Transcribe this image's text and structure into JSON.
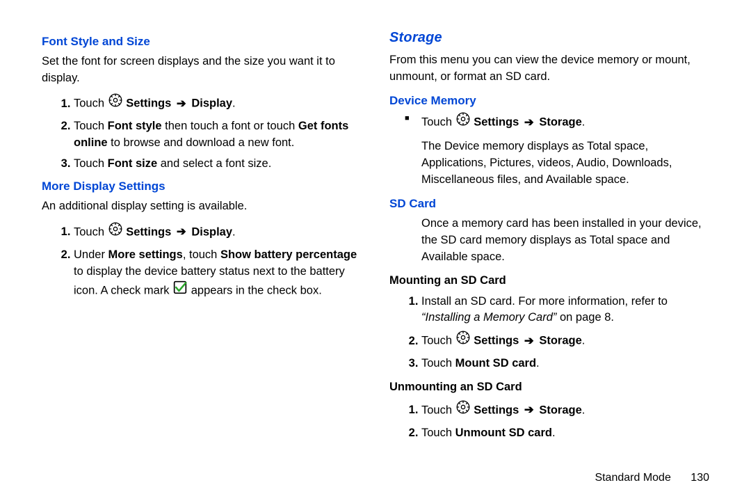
{
  "left": {
    "heading_font": "Font Style and Size",
    "font_intro": "Set the font for screen displays and the size you want it to display.",
    "font_step1_a": "Touch ",
    "font_step1_b": "Settings",
    "font_step1_c": "Display",
    "font_step2_a": "Touch ",
    "font_step2_fs": "Font style",
    "font_step2_b": " then touch a font or touch ",
    "font_step2_gf": "Get fonts online",
    "font_step2_c": " to browse and download a new font.",
    "font_step3_a": "Touch ",
    "font_step3_b": "Font size",
    "font_step3_c": " and select a font size.",
    "heading_more": "More Display Settings",
    "more_intro": "An additional display setting is available.",
    "more_step1_a": "Touch ",
    "more_step1_b": "Settings",
    "more_step1_c": "Display",
    "more_step2_a": "Under ",
    "more_step2_ms": "More settings",
    "more_step2_b": ", touch ",
    "more_step2_sbp": "Show battery percentage",
    "more_step2_c": " to display the device battery status next to the battery icon. A check mark ",
    "more_step2_d": " appears in the check box."
  },
  "right": {
    "heading_storage": "Storage",
    "storage_intro": "From this menu you can view the device memory or mount, unmount, or format an SD card.",
    "heading_devmem": "Device Memory",
    "devmem_b1_a": "Touch ",
    "devmem_b1_b": "Settings",
    "devmem_b1_c": "Storage",
    "devmem_para": "The Device memory displays as Total space, Applications, Pictures, videos, Audio, Downloads, Miscellaneous files, and Available space.",
    "heading_sd": "SD Card",
    "sd_para": "Once a memory card has been installed in your device, the SD card memory displays as Total space and Available space.",
    "h_mount": "Mounting an SD Card",
    "mount1_a": "Install an SD card. For more information, refer to ",
    "mount1_ital": "“Installing a Memory Card”",
    "mount1_b": " on page 8.",
    "mount2_a": "Touch ",
    "mount2_b": "Settings",
    "mount2_c": "Storage",
    "mount3_a": "Touch ",
    "mount3_b": "Mount SD card",
    "h_unmount": "Unmounting an SD Card",
    "unmount1_a": "Touch ",
    "unmount1_b": "Settings",
    "unmount1_c": "Storage",
    "unmount2_a": "Touch ",
    "unmount2_b": "Unmount SD card"
  },
  "footer": {
    "mode": "Standard Mode",
    "page": "130"
  },
  "glyphs": {
    "arrow": "➔"
  }
}
